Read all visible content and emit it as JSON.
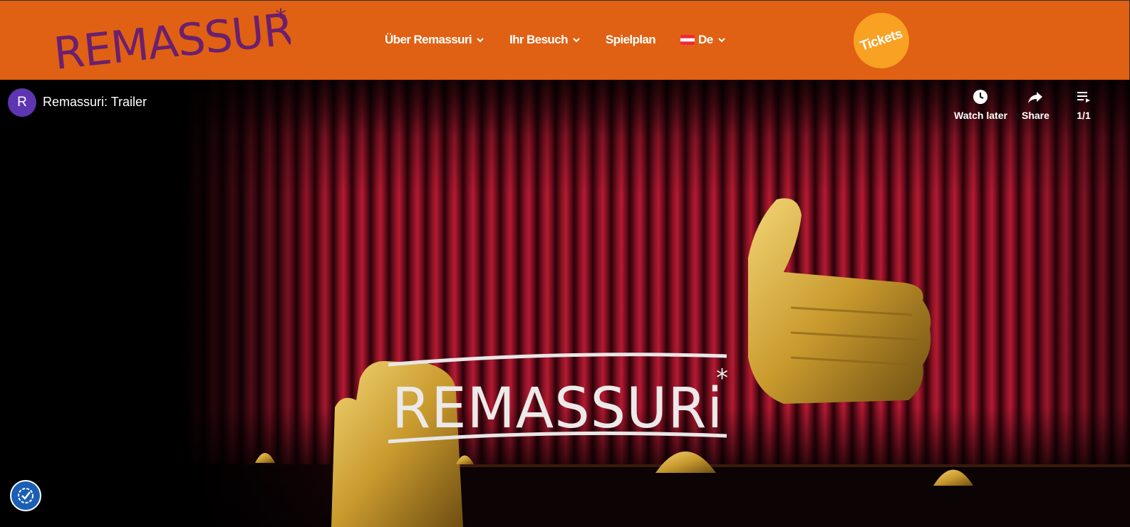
{
  "header": {
    "logo_text": "REMASSURi",
    "nav": [
      {
        "label": "Über Remassuri",
        "has_dropdown": true
      },
      {
        "label": "Ihr Besuch",
        "has_dropdown": true
      },
      {
        "label": "Spielplan",
        "has_dropdown": false
      },
      {
        "label": "De",
        "has_dropdown": true,
        "icon": "austria-flag-icon"
      }
    ],
    "tickets_label": "Tickets"
  },
  "video": {
    "channel_initial": "R",
    "title": "Remassuri: Trailer",
    "watch_later_label": "Watch later",
    "share_label": "Share",
    "playlist_label": "1/1",
    "stage_sign_text": "REMASSURi"
  },
  "colors": {
    "header_bg": "#e06113",
    "logo": "#6b1f6e",
    "tickets_bg": "#f9a122",
    "curtain": "#8e1326",
    "gold": "#c99a2e"
  }
}
